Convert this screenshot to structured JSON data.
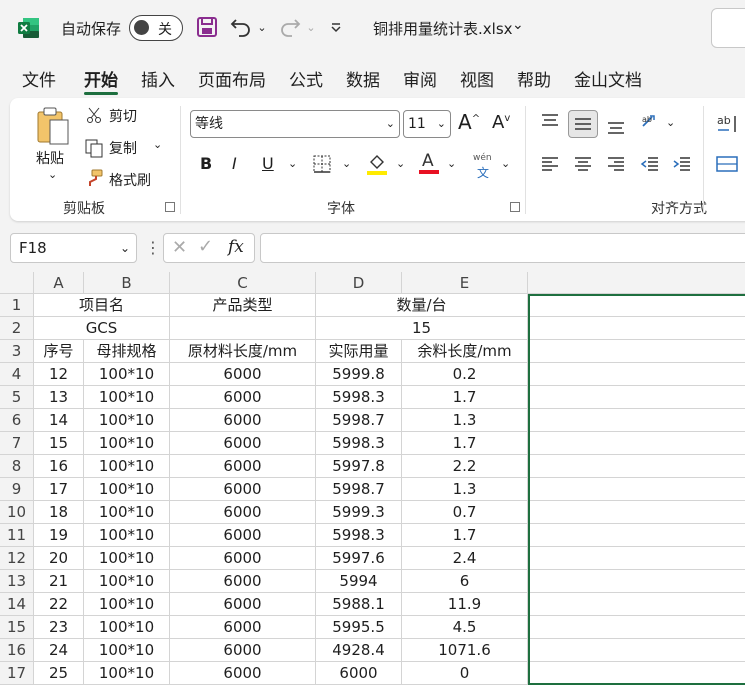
{
  "title_bar": {
    "autosave_label": "自动保存",
    "toggle_state": "关",
    "filename": "铜排用量统计表.xlsx"
  },
  "menu": {
    "tabs": [
      "文件",
      "开始",
      "插入",
      "页面布局",
      "公式",
      "数据",
      "审阅",
      "视图",
      "帮助",
      "金山文档"
    ],
    "active": "开始"
  },
  "ribbon": {
    "clipboard": {
      "paste": "粘贴",
      "cut": "剪切",
      "copy": "复制",
      "format_painter": "格式刷",
      "group_label": "剪贴板"
    },
    "font": {
      "font_name": "等线",
      "font_size": "11",
      "bold": "B",
      "italic": "I",
      "underline": "U",
      "font_color_glyph": "A",
      "wen": "wén",
      "wen_char": "文",
      "group_label": "字体"
    },
    "alignment": {
      "group_label": "对齐方式"
    }
  },
  "formula_bar": {
    "cell_ref": "F18",
    "fx": "fx",
    "value": ""
  },
  "sheet": {
    "columns": [
      "A",
      "B",
      "C",
      "D",
      "E"
    ],
    "row_numbers": [
      "1",
      "2",
      "3",
      "4",
      "5",
      "6",
      "7",
      "8",
      "9",
      "10",
      "11",
      "12",
      "13",
      "14",
      "15",
      "16",
      "17"
    ],
    "header_row1": {
      "project": "项目名",
      "product_type": "产品类型",
      "quantity": "数量/台"
    },
    "header_row2": {
      "project": "GCS",
      "quantity": "15"
    },
    "header_row3": [
      "序号",
      "母排规格",
      "原材料长度/mm",
      "实际用量",
      "余料长度/mm"
    ],
    "rows": [
      [
        "12",
        "100*10",
        "6000",
        "5999.8",
        "0.2"
      ],
      [
        "13",
        "100*10",
        "6000",
        "5998.3",
        "1.7"
      ],
      [
        "14",
        "100*10",
        "6000",
        "5998.7",
        "1.3"
      ],
      [
        "15",
        "100*10",
        "6000",
        "5998.3",
        "1.7"
      ],
      [
        "16",
        "100*10",
        "6000",
        "5997.8",
        "2.2"
      ],
      [
        "17",
        "100*10",
        "6000",
        "5998.7",
        "1.3"
      ],
      [
        "18",
        "100*10",
        "6000",
        "5999.3",
        "0.7"
      ],
      [
        "19",
        "100*10",
        "6000",
        "5998.3",
        "1.7"
      ],
      [
        "20",
        "100*10",
        "6000",
        "5997.6",
        "2.4"
      ],
      [
        "21",
        "100*10",
        "6000",
        "5994",
        "6"
      ],
      [
        "22",
        "100*10",
        "6000",
        "5988.1",
        "11.9"
      ],
      [
        "23",
        "100*10",
        "6000",
        "5995.5",
        "4.5"
      ],
      [
        "24",
        "100*10",
        "6000",
        "4928.4",
        "1071.6"
      ],
      [
        "25",
        "100*10",
        "6000",
        "6000",
        "0"
      ]
    ]
  },
  "colors": {
    "accent": "#1e6f3f",
    "excel_green": "#107c41",
    "save_purple": "#8a2d8f"
  }
}
